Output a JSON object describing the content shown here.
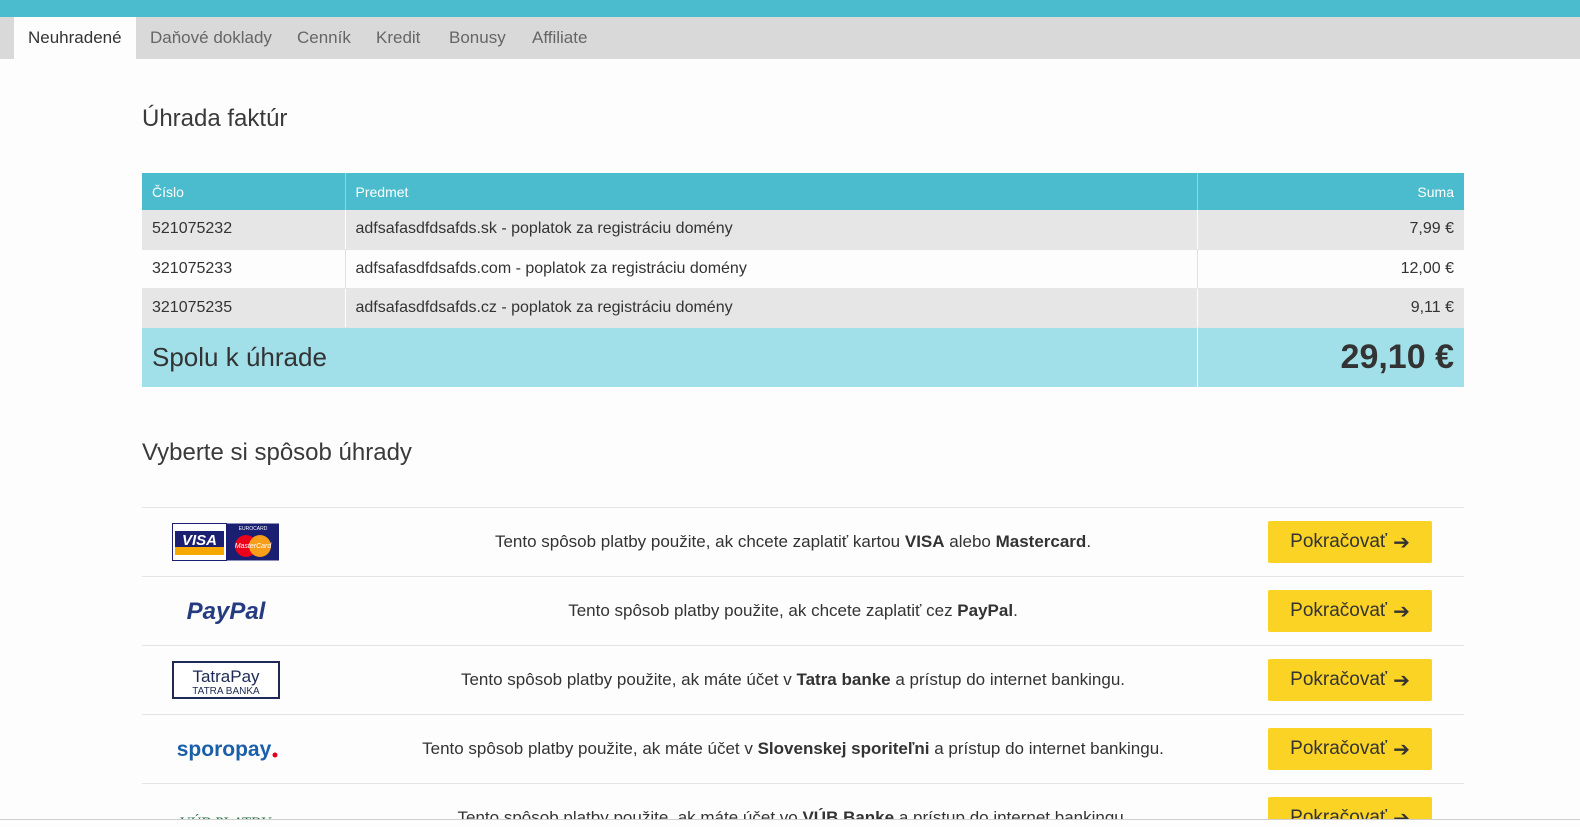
{
  "tabs": [
    {
      "label": "Neuhradené",
      "active": true
    },
    {
      "label": "Daňové doklady"
    },
    {
      "label": "Cenník"
    },
    {
      "label": "Kredit"
    },
    {
      "label": "Bonusy"
    },
    {
      "label": "Affiliate"
    }
  ],
  "invoices": {
    "title": "Úhrada faktúr",
    "columns": {
      "number": "Číslo",
      "subject": "Predmet",
      "amount": "Suma"
    },
    "rows": [
      {
        "number": "521075232",
        "subject": "adfsafasdfdsafds.sk - poplatok za registráciu domény",
        "amount": "7,99 €"
      },
      {
        "number": "321075233",
        "subject": "adfsafasdfdsafds.com - poplatok za registráciu domény",
        "amount": "12,00 €"
      },
      {
        "number": "321075235",
        "subject": "adfsafasdfdsafds.cz - poplatok za registráciu domény",
        "amount": "9,11 €"
      }
    ],
    "total_label": "Spolu k úhrade",
    "total_value": "29,10 €"
  },
  "payment": {
    "title": "Vyberte si spôsob úhrady",
    "button_label": "Pokračovať",
    "methods": [
      {
        "logo": "visa-mastercard-logo",
        "logo_text": [
          "VISA",
          "EUROCARD",
          "MasterCard"
        ],
        "text_before": "Tento spôsob platby použite, ak chcete zaplatiť kartou ",
        "bold1": "VISA",
        "mid": " alebo ",
        "bold2": "Mastercard",
        "text_after": "."
      },
      {
        "logo": "paypal-logo",
        "logo_text": [
          "PayPal"
        ],
        "text_before": "Tento spôsob platby použite, ak chcete zaplatiť cez ",
        "bold1": "PayPal",
        "text_after": "."
      },
      {
        "logo": "tatrapay-logo",
        "logo_text": [
          "TatraPay",
          "TATRA BANKA"
        ],
        "text_before": "Tento spôsob platby použite, ak máte účet v ",
        "bold1": "Tatra banke",
        "text_after": " a prístup do internet bankingu."
      },
      {
        "logo": "sporopay-logo",
        "logo_text": [
          "sporopay"
        ],
        "text_before": "Tento spôsob platby použite, ak máte účet v ",
        "bold1": "Slovenskej sporiteľni",
        "text_after": " a prístup do internet bankingu."
      },
      {
        "logo": "vub-platby-logo",
        "logo_text": [
          "VÚB PLATBY"
        ],
        "text_before": "Tento spôsob platby použite, ak máte účet vo ",
        "bold1": "VÚB Banke",
        "text_after": " a prístup do internet bankingu."
      }
    ]
  },
  "colors": {
    "accent": "#4bbccd",
    "total_bg": "#a2e0e9",
    "button": "#fbd324"
  }
}
